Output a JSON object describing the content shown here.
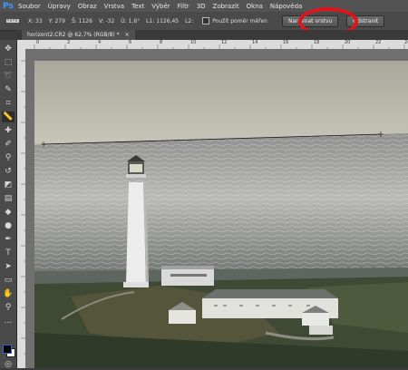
{
  "menu": {
    "logo": "Ps",
    "items": [
      "Soubor",
      "Úpravy",
      "Obraz",
      "Vrstva",
      "Text",
      "Výběr",
      "Filtr",
      "3D",
      "Zobrazit",
      "Okna",
      "Nápověda"
    ]
  },
  "options_bar": {
    "x": "X: 33",
    "y": "Y: 279",
    "w": "Š: 1126",
    "h": "V: -32",
    "angle": "Ú: 1,6°",
    "l1": "L1: 1126,45",
    "l2": "L2:",
    "checkbox_label": "Použít poměr měřen",
    "straighten_button": "Narovnat vrstvu",
    "clear_button": "Odstranit"
  },
  "document_tab": {
    "title": "horizont2.CR2 @ 62,7% (RGB/8) *"
  },
  "ruler": {
    "top_labels": [
      "0",
      "2",
      "4",
      "6",
      "8",
      "10",
      "12",
      "14",
      "16",
      "18",
      "20",
      "22",
      "24"
    ]
  },
  "tools": [
    "move-tool",
    "marquee-tool",
    "lasso-tool",
    "quick-select-tool",
    "crop-tool",
    "ruler-tool",
    "healing-brush-tool",
    "brush-tool",
    "clone-stamp-tool",
    "history-brush-tool",
    "eraser-tool",
    "gradient-tool",
    "blur-tool",
    "dodge-tool",
    "pen-tool",
    "type-tool",
    "path-select-tool",
    "shape-tool",
    "hand-tool",
    "zoom-tool"
  ],
  "colors": {
    "highlight": "#e0141c",
    "foreground": "#000000",
    "background": "#ffffff",
    "accent": "#2a63c9"
  }
}
